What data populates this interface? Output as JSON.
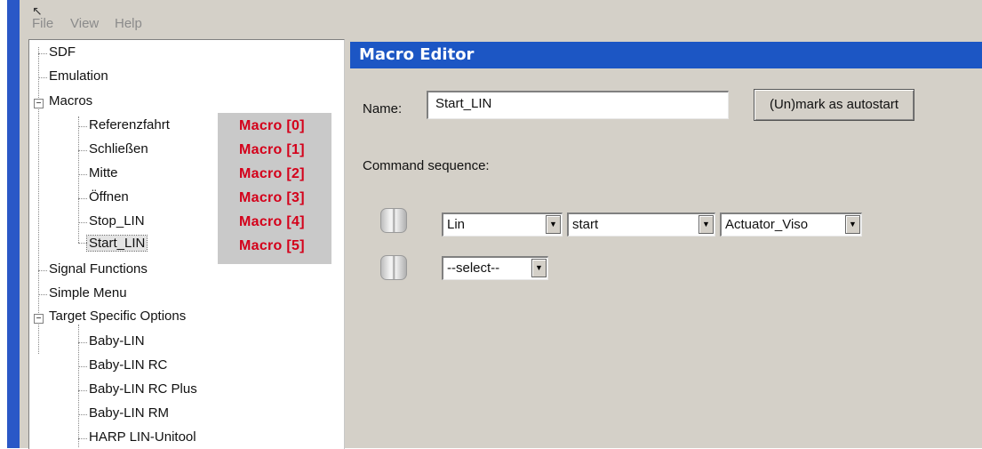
{
  "menu": {
    "items": [
      "File",
      "View",
      "Help"
    ]
  },
  "tree": {
    "sdf": "SDF",
    "emulation": "Emulation",
    "macros": "Macros",
    "macro_items": [
      "Referenzfahrt",
      "Schließen",
      "Mitte",
      "Öffnen",
      "Stop_LIN",
      "Start_LIN"
    ],
    "signal_functions": "Signal Functions",
    "simple_menu": "Simple Menu",
    "target_specific": "Target Specific Options",
    "target_items": [
      "Baby-LIN",
      "Baby-LIN RC",
      "Baby-LIN RC Plus",
      "Baby-LIN RM",
      "HARP LIN-Unitool"
    ],
    "expander_symbol": "−"
  },
  "macro_labels": [
    "Macro [0]",
    "Macro [1]",
    "Macro [2]",
    "Macro [3]",
    "Macro [4]",
    "Macro [5]"
  ],
  "editor": {
    "title": "Macro Editor",
    "name_label": "Name:",
    "name_value": "Start_LIN",
    "autostart_button": "(Un)mark as autostart",
    "command_label": "Command sequence:",
    "row1": {
      "combo1": "Lin",
      "combo2": "start",
      "combo3": "Actuator_Viso"
    },
    "row2": {
      "combo1": "--select--"
    }
  },
  "colors": {
    "header_blue": "#1c56c4",
    "macro_red": "#d4001a",
    "window_gray": "#d4d0c8"
  }
}
